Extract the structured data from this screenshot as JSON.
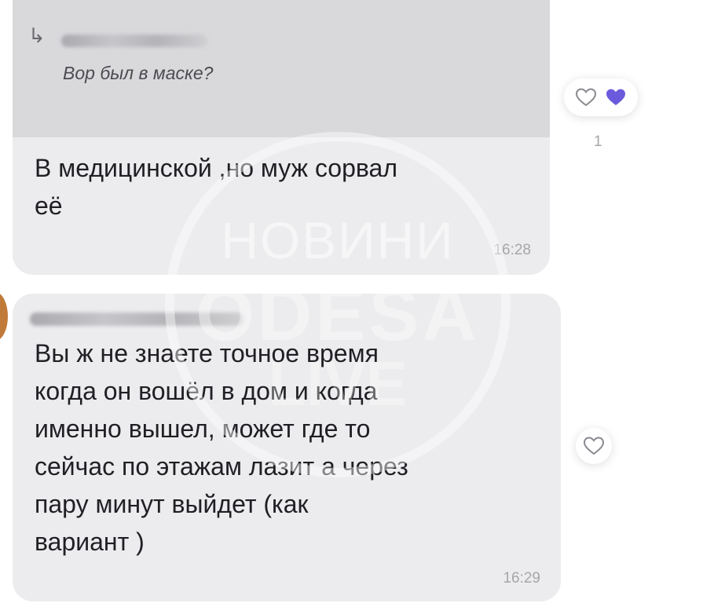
{
  "messages": [
    {
      "reply": {
        "author": "",
        "quoted_text": "Вор был в маске?"
      },
      "text": "В медицинской ,но муж сорвал\nеё",
      "time": "16:28",
      "reactions": {
        "count": "1",
        "liked": true
      }
    },
    {
      "author": "",
      "text": "Вы ж не знаете точное время\nкогда он вошёл в дом и когда\nименно вышел, может где то\nсейчас по этажам лазит а через\nпару минут выйдет (как\nвариант )",
      "time": "16:29",
      "reactions": {
        "liked": false
      }
    }
  ],
  "watermark": {
    "title": "НОВИНИ",
    "subtitle": "ODESA",
    "tag": "LIVE"
  },
  "colors": {
    "bubble": "#ececee",
    "reply_block": "#d9d9dc",
    "heart_filled": "#6b5bdc",
    "heart_outline": "#8a8a90"
  },
  "icons": {
    "reply": "reply-arrow-icon",
    "heart_outline": "heart-outline-icon",
    "heart_filled": "heart-filled-icon"
  }
}
